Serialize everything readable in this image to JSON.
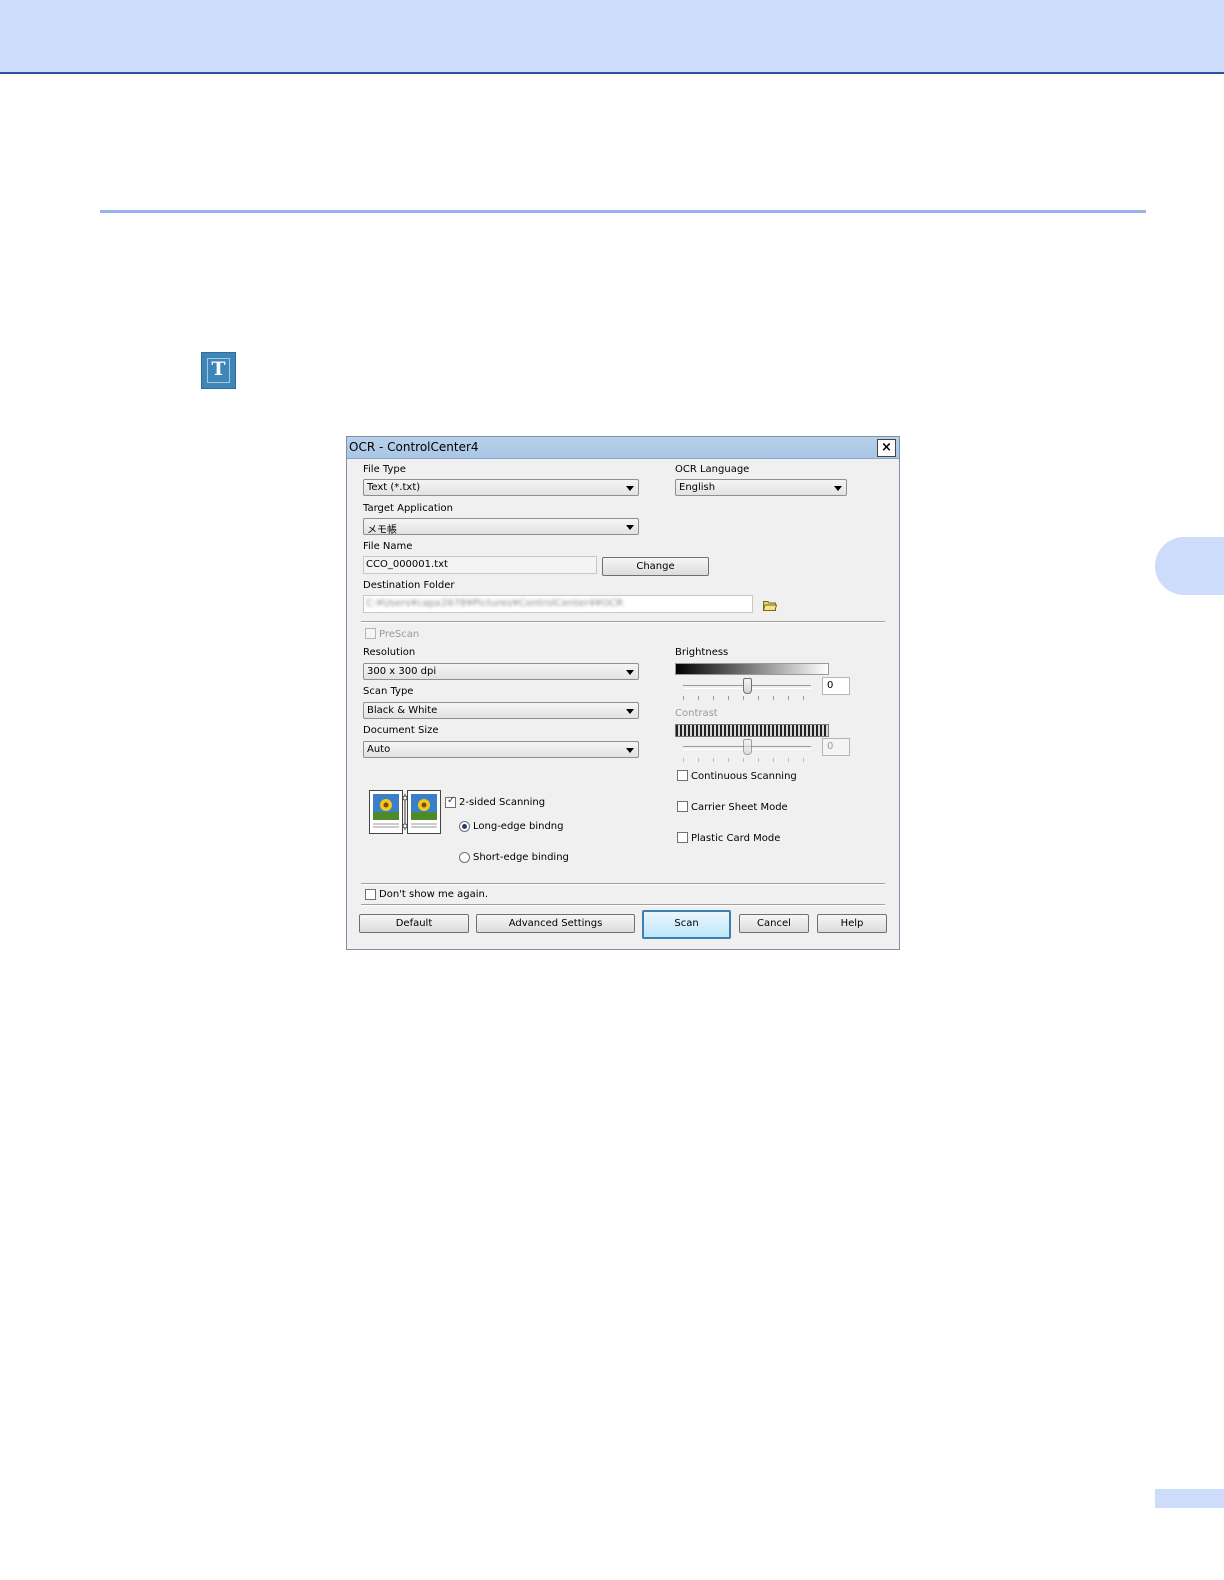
{
  "dialog": {
    "title": "OCR - ControlCenter4",
    "file_type": {
      "label": "File Type",
      "value": "Text (*.txt)"
    },
    "ocr_language": {
      "label": "OCR Language",
      "value": "English"
    },
    "target_application": {
      "label": "Target Application",
      "value": "メモ帳"
    },
    "file_name": {
      "label": "File Name",
      "value": "CCO_000001.txt",
      "change_button": "Change"
    },
    "destination_folder": {
      "label": "Destination Folder",
      "value": "C:¥Users¥capx2678¥Pictures¥ControlCenter4¥OCR"
    },
    "prescan": {
      "label": "PreScan",
      "checked": false
    },
    "resolution": {
      "label": "Resolution",
      "value": "300 x 300 dpi"
    },
    "scan_type": {
      "label": "Scan Type",
      "value": "Black & White"
    },
    "document_size": {
      "label": "Document Size",
      "value": "Auto"
    },
    "brightness": {
      "label": "Brightness",
      "value": "0"
    },
    "contrast": {
      "label": "Contrast",
      "value": "0"
    },
    "continuous_scanning": {
      "label": "Continuous Scanning",
      "checked": false
    },
    "carrier_sheet_mode": {
      "label": "Carrier Sheet Mode",
      "checked": false
    },
    "plastic_card_mode": {
      "label": "Plastic Card Mode",
      "checked": false
    },
    "two_sided": {
      "label": "2-sided Scanning",
      "checked": true
    },
    "long_edge": {
      "label": "Long-edge bindng",
      "selected": true
    },
    "short_edge": {
      "label": "Short-edge binding",
      "selected": false
    },
    "dont_show": {
      "label": "Don't show me again.",
      "checked": false
    },
    "buttons": {
      "default": "Default",
      "advanced": "Advanced Settings",
      "scan": "Scan",
      "cancel": "Cancel",
      "help": "Help"
    }
  },
  "colors": {
    "header_band": "#cddcfb",
    "header_rule": "#2f4fa8",
    "section_rule": "#98b2ec",
    "ocr_icon": "#3e86b8"
  },
  "icons": {
    "ocr_app_icon": "T",
    "close": "×"
  }
}
